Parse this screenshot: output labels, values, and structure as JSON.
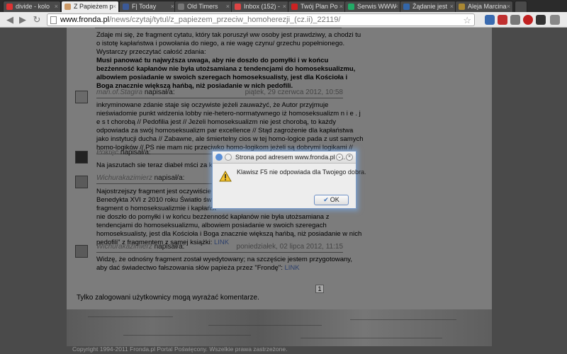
{
  "tabs": [
    {
      "label": "divide - kolo",
      "color": "#d33"
    },
    {
      "label": "Z Papieżem p",
      "color": "#c96",
      "active": true
    },
    {
      "label": "F| Today",
      "color": "#3b5998"
    },
    {
      "label": "Old Timers",
      "color": "#777"
    },
    {
      "label": "Inbox (152) -",
      "color": "#d44"
    },
    {
      "label": "Twój Plan Po",
      "color": "#c22"
    },
    {
      "label": "Serwis WWW",
      "color": "#2a6"
    },
    {
      "label": "Żądanie jest",
      "color": "#36a"
    },
    {
      "label": "Aleja Marcina",
      "color": "#a83"
    }
  ],
  "toolbar": {
    "back": "◀",
    "forward": "▶",
    "reload": "↻",
    "url_host": "www.fronda.pl",
    "url_path": "/news/czytaj/tytul/z_papiezem_przeciw_homoherezji_(cz.ii)_22119/",
    "star": "☆"
  },
  "comments": {
    "c0": {
      "lines": [
        "Zdaje mi się, że fragment cytatu, który tak poruszył ww osoby jest prawdziwy, a chodzi tu",
        "o istotę kapłaństwa i powołania do niego, a nie wagę czynu/ grzechu popełnionego.",
        "Wystarczy przeczytać całość zdania:"
      ],
      "bold_lines": [
        "Musi panować tu najwyższa uwaga, aby nie doszło do pomyłki i w końcu",
        "bezżenność kapłanów nie była utożsamiana z tendencjami do homoseksualizmu,",
        "albowiem posiadanie w swoich szeregach homoseksualisty, jest dla Kościoła i",
        "Boga znacznie większą hańbą, niż posiadanie w nich pedofili."
      ]
    },
    "c1": {
      "author": "man.of.Stagira",
      "suffix": " napisał/a:",
      "date": "piątek, 29 czerwca 2012, 10:58",
      "lines": [
        "inkryminowane zdanie staje się oczywiste jeżeli zauważyć, że Autor przyjmuje",
        "nieświadomie punkt widzenia lobby nie-hetero-normatywnego iż homoseksualizm n i e . j",
        "e s t chorobą // Pedofilia jest // Jeżeli homoseksualizm nie jest chorobą, to każdy",
        "odpowiada za swój homoseksualizm par excellence // Stąd zagrożenie dla kapłaństwa",
        "jako instytucji ducha // Zabawne, ale śmiertelny cios w tej homo-logice pada z ust samych",
        "homo-logików // PS nie mam nic przeciwko homo-logikom jeżeli są dobrymi logikami //"
      ]
    },
    "c2": {
      "author": "Pokręć",
      "suffix": " napisał/a:",
      "lines": [
        "Na jaszutach sie teraz diabeł mści za kontr"
      ]
    },
    "c3": {
      "author": "Wichurakazimierz",
      "suffix": " napisał/a:",
      "lines": [
        "Najostrzejszy fragment jest oczywiście zaf",
        "Benedykta XVI z 2010 roku Światło świata",
        "fragment o homoseksualizmie i kapłańst",
        "nie doszło do pomyłki i w końcu bezżenność kapłanów nie była utożsamiana z",
        "tendencjami do homoseksualizmu, albowiem posiadanie w swoich szeregach",
        "homoseksualisty, jest dla Kościoła i Boga znacznie większą hańbą, niż posiadanie w nich",
        "pedofili\" z fragmentem z samej książki:"
      ],
      "link": "LINK"
    },
    "c4": {
      "author": "Wichurakazimierz",
      "suffix": " napisał/a:",
      "date": "poniedziałek, 02 lipca 2012, 11:15",
      "lines": [
        "Widzę, że odnośny fragment został wyedytowany; na szczęście jestem przygotowany,",
        "aby dać świadectwo fałszowania słów papieża przez \"Frondę\":"
      ],
      "link": "LINK"
    }
  },
  "footer": {
    "note": "Tylko zalogowani użytkownicy mogą wyrażać komentarze.",
    "page": "1",
    "copyright": "Copyright 1994-2011 Fronda.pl Portal Poświęcony. Wszelkie prawa zastrzeżone."
  },
  "dialog": {
    "title": "Strona pod adresem www.fronda.pl s...",
    "message": "Klawisz F5 nie odpowiada dla Twojego dobra.",
    "ok_label": "OK",
    "ok_check": "✔",
    "warn_icon": "warning-icon"
  }
}
